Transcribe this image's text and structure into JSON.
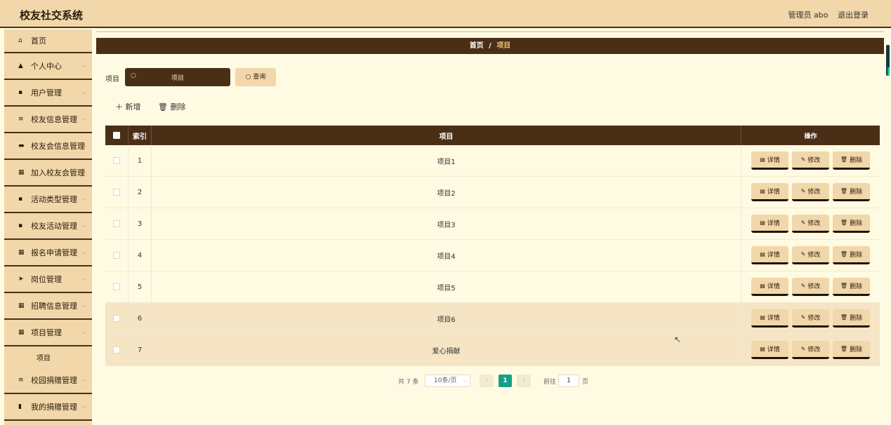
{
  "app": {
    "title": "校友社交系统"
  },
  "header": {
    "user": "管理员 abo",
    "logout": "退出登录"
  },
  "sidebar": {
    "items": [
      {
        "label": "首页",
        "icon": "home-icon",
        "glyph": "⌂"
      },
      {
        "label": "个人中心",
        "icon": "user-icon",
        "glyph": "▲"
      },
      {
        "label": "用户管理",
        "icon": "id-card-icon",
        "glyph": "▪"
      },
      {
        "label": "校友信息管理",
        "icon": "sliders-icon",
        "glyph": "≡"
      },
      {
        "label": "校友会信息管理",
        "icon": "briefcase-icon",
        "glyph": "▬"
      },
      {
        "label": "加入校友会管理",
        "icon": "grid-icon",
        "glyph": "▦"
      },
      {
        "label": "活动类型管理",
        "icon": "clipboard-icon",
        "glyph": "▪"
      },
      {
        "label": "校友活动管理",
        "icon": "thumbs-up-icon",
        "glyph": "▪"
      },
      {
        "label": "报名申请管理",
        "icon": "grid-icon",
        "glyph": "▦"
      },
      {
        "label": "岗位管理",
        "icon": "send-icon",
        "glyph": "➤"
      },
      {
        "label": "招聘信息管理",
        "icon": "grid-icon",
        "glyph": "▦"
      },
      {
        "label": "项目管理",
        "icon": "grid-icon",
        "glyph": "▦"
      },
      {
        "label": "校园捐赠管理",
        "icon": "list-icon",
        "glyph": "≡"
      },
      {
        "label": "我的捐赠管理",
        "icon": "bar-chart-icon",
        "glyph": "▮"
      }
    ],
    "sub_item": "项目"
  },
  "breadcrumb": {
    "home": "首页",
    "sep": "/",
    "current": "项目"
  },
  "search": {
    "label": "项目",
    "placeholder": "项目",
    "button": "查询"
  },
  "toolbar": {
    "add": "新增",
    "delete": "删除"
  },
  "table": {
    "headers": [
      "索引",
      "项目",
      "操作"
    ],
    "rows": [
      {
        "idx": "1",
        "name": "项目1"
      },
      {
        "idx": "2",
        "name": "项目2"
      },
      {
        "idx": "3",
        "name": "项目3"
      },
      {
        "idx": "4",
        "name": "项目4"
      },
      {
        "idx": "5",
        "name": "项目5"
      },
      {
        "idx": "6",
        "name": "项目6"
      },
      {
        "idx": "7",
        "name": "爱心捐献"
      }
    ],
    "actions": {
      "detail": "详情",
      "edit": "修改",
      "delete": "删除"
    }
  },
  "pagination": {
    "total": "共 7 条",
    "page_size": "10条/页",
    "current": "1",
    "goto_label": "前往",
    "goto_value": "1",
    "page_suffix": "页"
  },
  "colors": {
    "accent": "#4a2f16",
    "light": "#f1d7a9",
    "page": "#fffbe3",
    "active": "#14a085"
  }
}
